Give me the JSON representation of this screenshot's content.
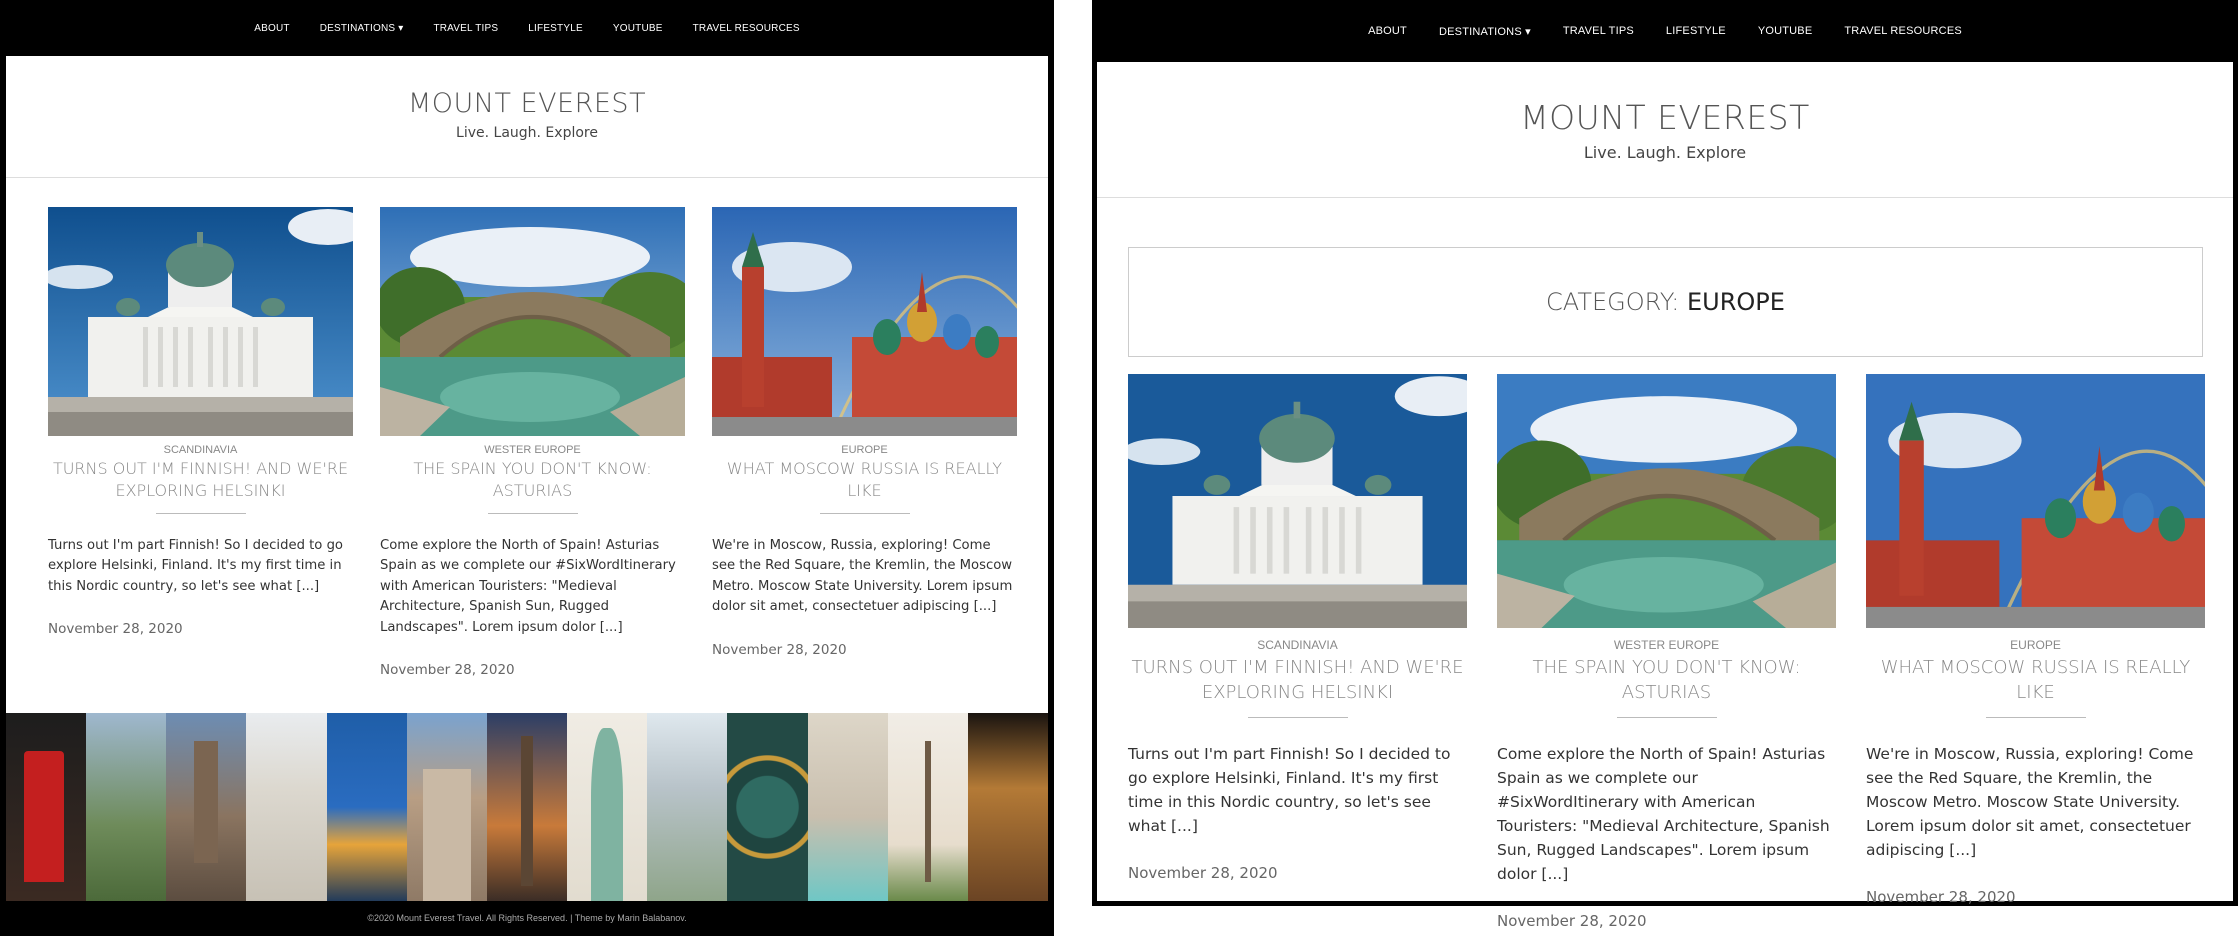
{
  "nav": {
    "items": [
      "ABOUT",
      "DESTINATIONS ▾",
      "TRAVEL TIPS",
      "LIFESTYLE",
      "YOUTUBE",
      "TRAVEL RESOURCES"
    ]
  },
  "site": {
    "title": "MOUNT EVEREST",
    "tagline": "Live. Laugh. Explore"
  },
  "category": {
    "prefix": "CATEGORY: ",
    "name": "EUROPE"
  },
  "posts": [
    {
      "category": "SCANDINAVIA",
      "title": "TURNS OUT I'M FINNISH! AND WE'RE EXPLORING HELSINKI",
      "excerpt": "Turns out I'm part Finnish! So I decided to go explore Helsinki, Finland. It's my first time in this Nordic country, so let's see what [...]",
      "date": "November 28, 2020"
    },
    {
      "category": "WESTER EUROPE",
      "title": "THE SPAIN YOU DON'T KNOW: ASTURIAS",
      "excerpt": "Come explore the North of Spain! Asturias Spain as we complete our #SixWordItinerary with American Touristers: \"Medieval Architecture, Spanish Sun, Rugged Landscapes\". Lorem ipsum dolor [...]",
      "date": "November 28, 2020"
    },
    {
      "category": "EUROPE",
      "title": "WHAT MOSCOW RUSSIA IS REALLY LIKE",
      "excerpt": "We're in Moscow, Russia, exploring! Come see the Red Square, the Kremlin, the Moscow Metro. Moscow State University. Lorem ipsum dolor sit amet, consectetuer adipiscing [...]",
      "date": "November 28, 2020"
    }
  ],
  "footer": {
    "text": "©2020 Mount Everest Travel. All Rights Reserved. | Theme by Marin Balabanov."
  }
}
